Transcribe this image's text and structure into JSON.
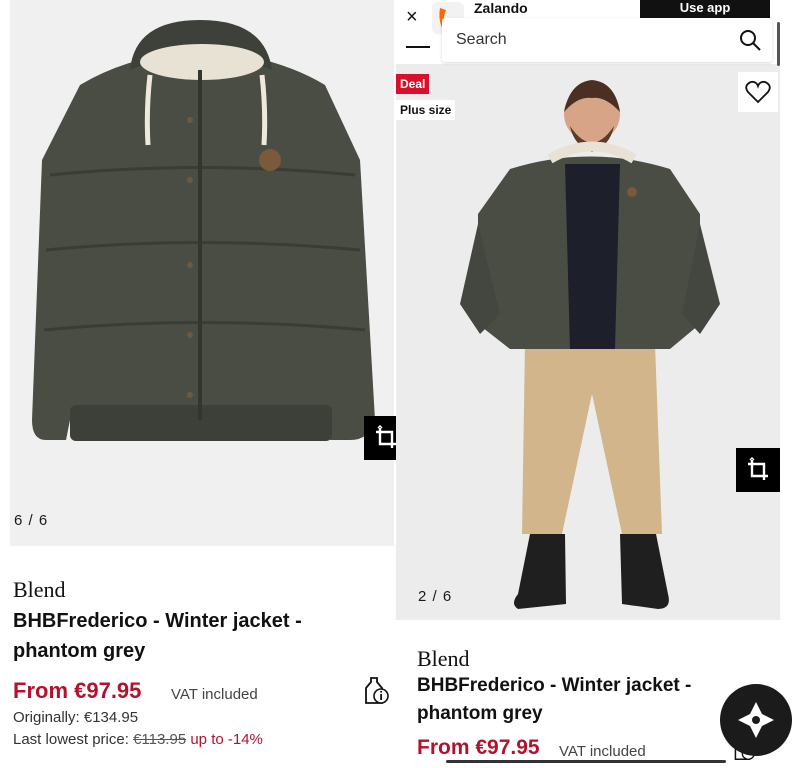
{
  "left": {
    "counter": "6 / 6",
    "brand": "Blend",
    "title": "BHBFrederico - Winter jacket - phantom grey",
    "price": "From €97.95",
    "vat": "VAT included",
    "originally": "Originally: €134.95",
    "lowest_prefix": "Last lowest price: ",
    "lowest_strike": "€113.95",
    "lowest_discount": " up to -14%"
  },
  "right": {
    "app_title": "Zalando",
    "close_symbol": "×",
    "use_app_label": "Use app",
    "search_placeholder": "Search",
    "badge_deal": "Deal",
    "badge_plus": "Plus size",
    "counter": "2 / 6",
    "brand": "Blend",
    "title": "BHBFrederico - Winter jacket - phantom grey",
    "price": "From €97.95",
    "vat": "VAT included"
  },
  "colors": {
    "price_red": "#b3122e",
    "deal_red": "#d8102b",
    "jacket": "#4a4d44",
    "background": "#f0f0f0"
  },
  "icons": [
    "close-icon",
    "zalando-logo",
    "menu-icon",
    "search-icon",
    "heart-icon",
    "crop-icon",
    "size-info-icon",
    "assistant-icon"
  ]
}
